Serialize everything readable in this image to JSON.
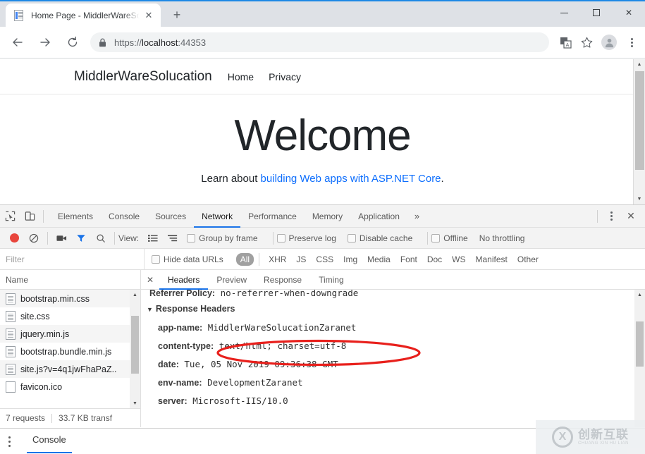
{
  "browser": {
    "tab": {
      "title": "Home Page - MiddlerWareSolucation",
      "favicon_icon": "document-icon",
      "close_icon": "close-icon"
    },
    "new_tab_label": "+",
    "window_controls": {
      "minimize": "minimize-icon",
      "maximize": "maximize-icon",
      "close": "close-icon"
    },
    "nav": {
      "back": "back-arrow-icon",
      "forward": "forward-arrow-icon",
      "reload": "reload-icon"
    },
    "omnibox": {
      "lock_icon": "lock-icon",
      "scheme": "https://",
      "host": "localhost",
      "port": ":44353",
      "url_full": "https://localhost:44353"
    },
    "toolbar_icons": {
      "translate": "translate-icon",
      "bookmark": "star-icon",
      "profile": "avatar-icon",
      "menu": "kebab-menu-icon"
    }
  },
  "page": {
    "brand": "MiddlerWareSolucation",
    "navlinks": [
      "Home",
      "Privacy"
    ],
    "heading": "Welcome",
    "lead_prefix": "Learn about ",
    "lead_link": "building Web apps with ASP.NET Core",
    "lead_suffix": "."
  },
  "devtools": {
    "icons": {
      "inspect": "inspect-element-icon",
      "device": "device-toggle-icon",
      "settings": "kebab-menu-icon",
      "close": "close-icon"
    },
    "tabs": [
      {
        "label": "Elements",
        "active": false
      },
      {
        "label": "Console",
        "active": false
      },
      {
        "label": "Sources",
        "active": false
      },
      {
        "label": "Network",
        "active": true
      },
      {
        "label": "Performance",
        "active": false
      },
      {
        "label": "Memory",
        "active": false
      },
      {
        "label": "Application",
        "active": false
      }
    ],
    "more_tabs": "»",
    "network_toolbar": {
      "record_icon": "record-icon",
      "clear_icon": "clear-icon",
      "capture_screenshots_icon": "camera-icon",
      "filter_icon": "filter-icon",
      "search_icon": "search-icon",
      "view_label": "View:",
      "view_list_icon": "list-view-icon",
      "view_waterfall_icon": "waterfall-view-icon",
      "group_by_frame": "Group by frame",
      "preserve_log": "Preserve log",
      "disable_cache": "Disable cache",
      "offline": "Offline",
      "throttling": "No throttling"
    },
    "filter_row": {
      "filter_placeholder": "Filter",
      "hide_data_urls": "Hide data URLs",
      "types": [
        "All",
        "XHR",
        "JS",
        "CSS",
        "Img",
        "Media",
        "Font",
        "Doc",
        "WS",
        "Manifest",
        "Other"
      ],
      "selected_type": "All"
    },
    "requests": {
      "column_header": "Name",
      "rows": [
        {
          "name": "bootstrap.min.css",
          "icon": "stylesheet-file-icon"
        },
        {
          "name": "site.css",
          "icon": "stylesheet-file-icon"
        },
        {
          "name": "jquery.min.js",
          "icon": "script-file-icon"
        },
        {
          "name": "bootstrap.bundle.min.js",
          "icon": "script-file-icon"
        },
        {
          "name": "site.js?v=4q1jwFhaPaZ..",
          "icon": "script-file-icon"
        },
        {
          "name": "favicon.ico",
          "icon": "image-file-icon"
        }
      ],
      "summary_requests": "7 requests",
      "summary_transferred": "33.7 KB transf"
    },
    "detail": {
      "close_icon": "close-icon",
      "tabs": [
        {
          "label": "Headers",
          "active": true
        },
        {
          "label": "Preview",
          "active": false
        },
        {
          "label": "Response",
          "active": false
        },
        {
          "label": "Timing",
          "active": false
        }
      ],
      "clipped_line_key": "Referrer Policy:",
      "clipped_line_value": "no-referrer-when-downgrade",
      "section_title": "Response Headers",
      "section_toggle_icon": "triangle-down-icon",
      "headers": [
        {
          "key": "app-name:",
          "value": "MiddlerWareSolucationZaranet",
          "highlighted": true
        },
        {
          "key": "content-type:",
          "value": "text/html; charset=utf-8",
          "highlighted": false
        },
        {
          "key": "date:",
          "value": "Tue, 05 Nov 2019 09:36:38 GMT",
          "highlighted": false
        },
        {
          "key": "env-name:",
          "value": "DevelopmentZaranet",
          "highlighted": false
        },
        {
          "key": "server:",
          "value": "Microsoft-IIS/10.0",
          "highlighted": false
        }
      ]
    },
    "drawer": {
      "menu_icon": "kebab-menu-icon",
      "tab_label": "Console"
    }
  },
  "annotation": {
    "shape": "ellipse",
    "color": "#e8201c",
    "targets": "app-name header value"
  },
  "watermark": {
    "mark": "X",
    "cn": "创新互联",
    "en": "CHUANG XIN HU LIAN"
  },
  "colors": {
    "accent": "#1a73e8",
    "annotation_red": "#e8201c",
    "link_blue": "#0d6efd",
    "record_red": "#e8453c"
  }
}
